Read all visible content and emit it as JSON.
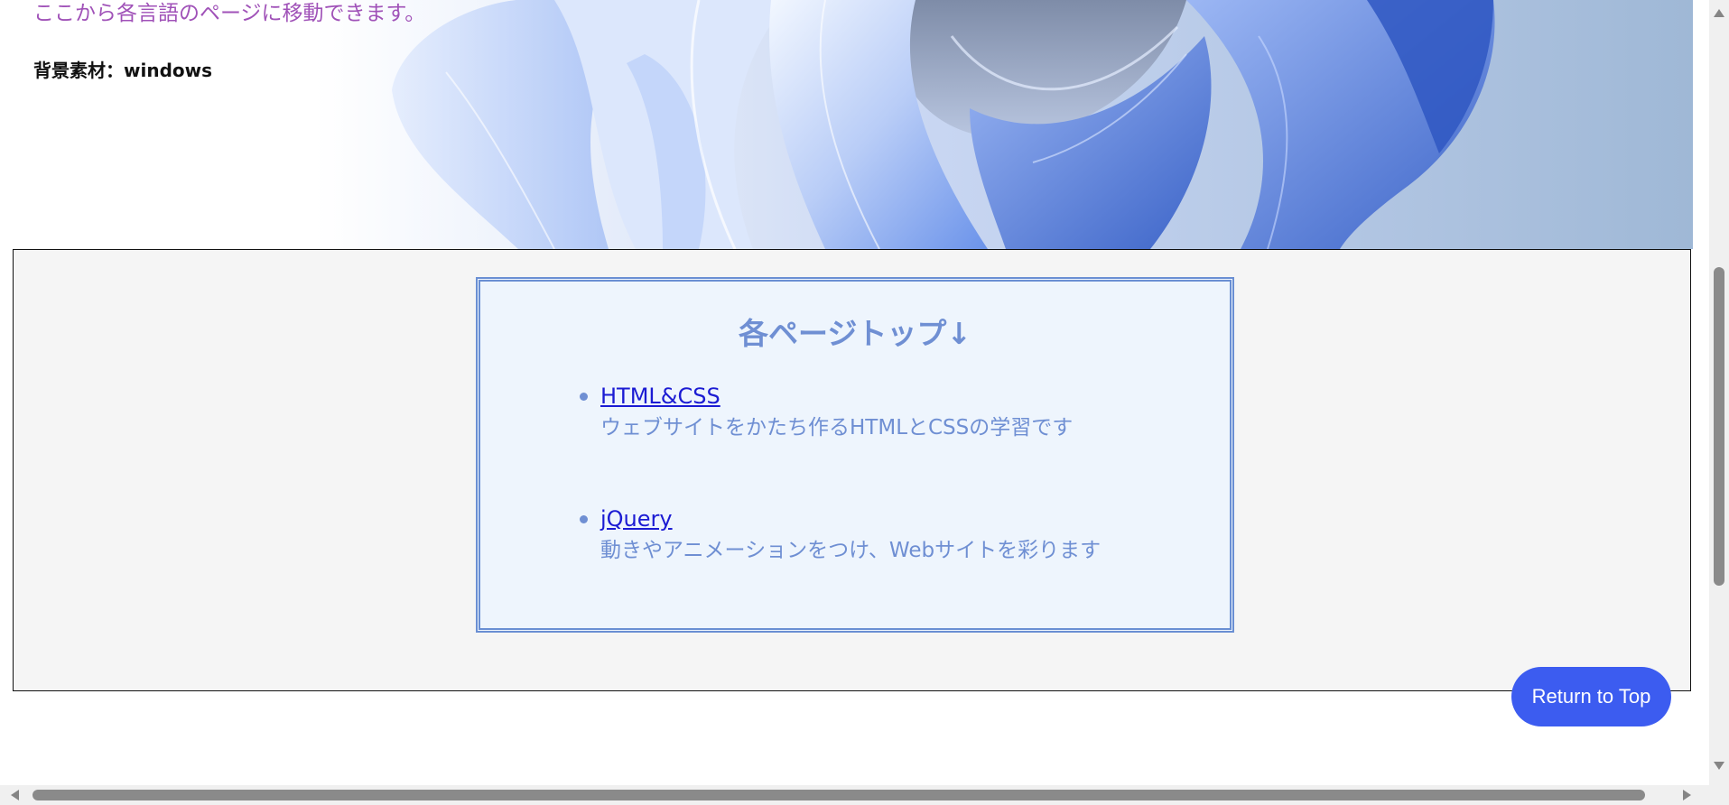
{
  "hero": {
    "lead": "ここから各言語のページに移動できます。",
    "credit": "背景素材：windows"
  },
  "card": {
    "title": "各ページトップ↓",
    "items": [
      {
        "link": "HTML&CSS",
        "description": "ウェブサイトをかたち作るHTMLとCSSの学習です"
      },
      {
        "link": "jQuery",
        "description": "動きやアニメーションをつけ、Webサイトを彩ります"
      }
    ]
  },
  "return_button": {
    "label": "Return to Top"
  },
  "colors": {
    "lead_text": "#a052b8",
    "card_accent": "#6f8fd3",
    "link": "#1b1bd3",
    "button": "#3c5cf0",
    "card_bg": "#eef5fd",
    "section_bg": "#f5f5f5"
  }
}
